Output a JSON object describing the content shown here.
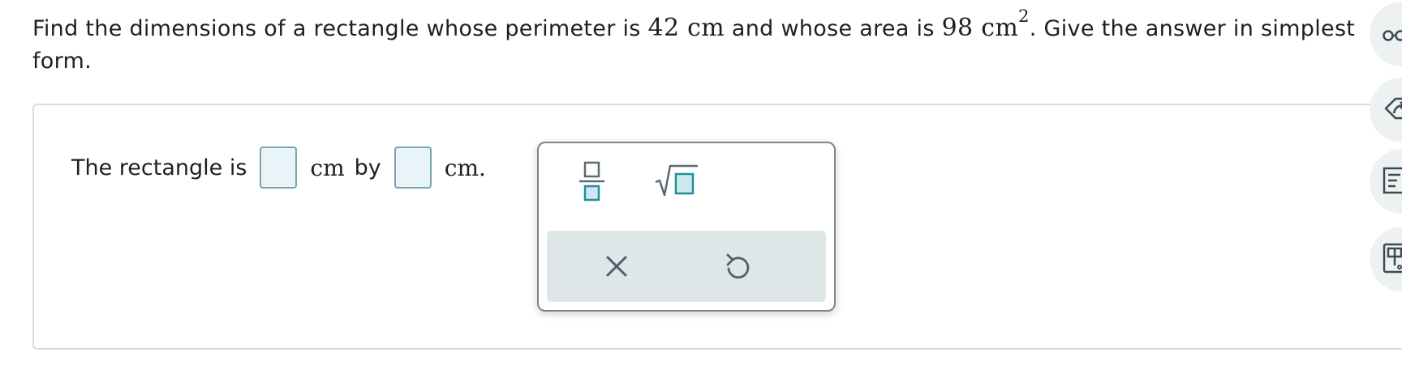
{
  "question": {
    "text_1": "Find the dimensions of a rectangle whose perimeter is ",
    "perimeter": "42 cm",
    "text_2": " and whose area is ",
    "area": "98 cm",
    "area_exponent": "2",
    "text_3": ". Give the answer in simplest form."
  },
  "answer": {
    "lead_text": "The rectangle is",
    "unit_by": "cm",
    "by_text": "by",
    "unit_end": "cm."
  },
  "palette": {
    "tools": [
      "fraction-tool",
      "sqrt-tool"
    ],
    "actions": [
      "clear",
      "undo"
    ]
  },
  "sidebar": {
    "icons": [
      "eyeglasses-icon",
      "reshare-icon",
      "reader-icon",
      "calculator-icon"
    ]
  },
  "colors": {
    "accent": "#1f8f9e",
    "box_fill": "#e8f4f8",
    "box_border": "#7aa6ad",
    "footer_bg": "#dfe6e8",
    "card_border": "#d6dcdf"
  }
}
